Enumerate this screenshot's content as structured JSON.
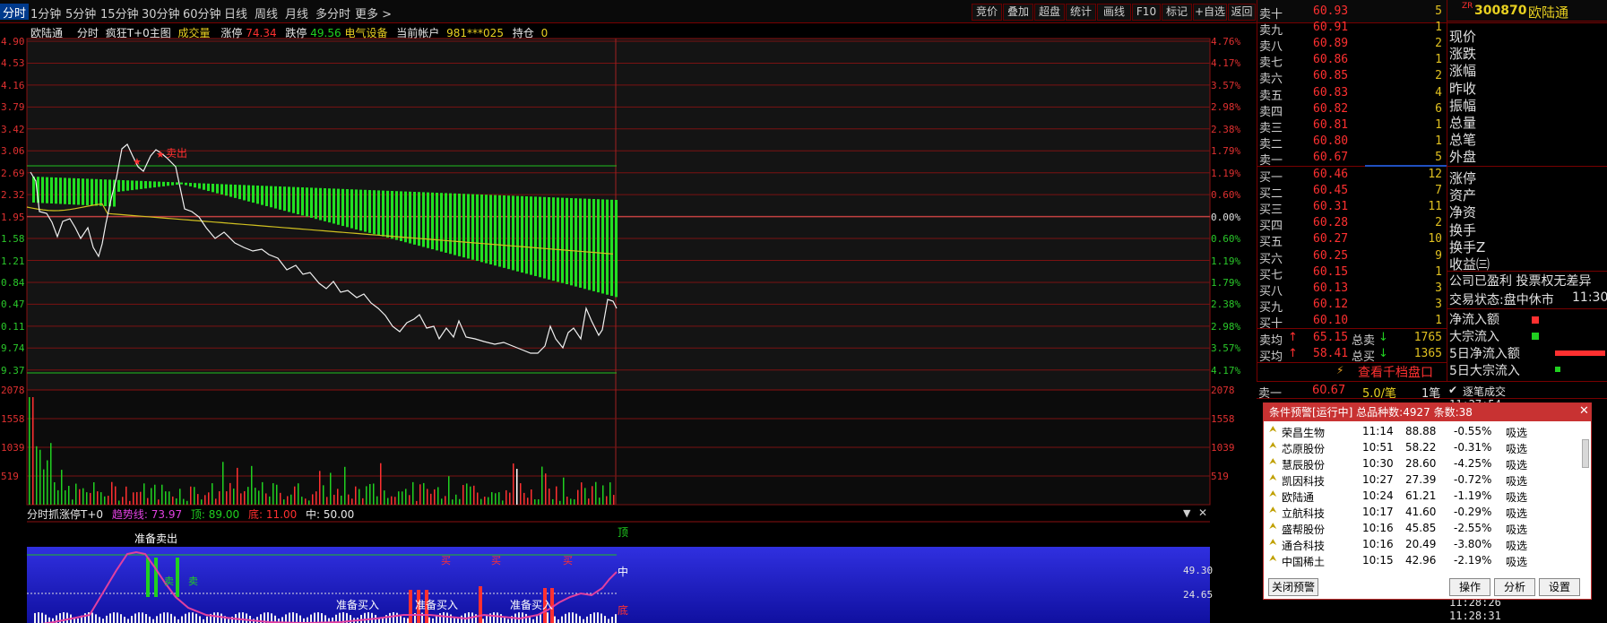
{
  "toolbar": {
    "periods": [
      "分时",
      "1分钟",
      "5分钟",
      "15分钟",
      "30分钟",
      "60分钟",
      "日线",
      "周线",
      "月线",
      "多分时",
      "更多 >"
    ],
    "right_buttons": [
      "竞价",
      "叠加",
      "超盘",
      "统计",
      "画线",
      "F10",
      "标记",
      "+自选",
      "返回"
    ]
  },
  "info_line": {
    "name": "欧陆通",
    "mode": "分时",
    "indicator": "疯狂T+0主图",
    "volume_label": "成交量",
    "limit_up_label": "涨停",
    "limit_up_value": "74.34",
    "limit_down_label": "跌停",
    "limit_down_value": "49.56",
    "sector": "电气设备",
    "account_label": "当前帐户",
    "account_value": "981***025",
    "position_label": "持仓",
    "position_value": "0"
  },
  "price_axis": {
    "left": [
      "4.90",
      "4.53",
      "4.16",
      "3.79",
      "3.42",
      "3.06",
      "2.69",
      "2.32",
      "1.95",
      "1.58",
      "1.21",
      "0.84",
      "0.47",
      "0.11",
      "9.74",
      "9.37"
    ],
    "right": [
      "4.76%",
      "4.17%",
      "3.57%",
      "2.98%",
      "2.38%",
      "1.79%",
      "1.19%",
      "0.60%",
      "0.00%",
      "0.60%",
      "1.19%",
      "1.79%",
      "2.38%",
      "2.98%",
      "3.57%",
      "4.17%"
    ]
  },
  "volume_axis": {
    "left": [
      "2078",
      "1558",
      "1039",
      "519"
    ],
    "right": [
      "2078",
      "1558",
      "1039",
      "519"
    ]
  },
  "chart_annotations": {
    "sell_out": "卖出"
  },
  "indicator2": {
    "title": "分时抓涨停T+0",
    "trend_label": "趋势线:",
    "trend_value": "73.97",
    "top_label": "顶:",
    "top_value": "89.00",
    "bottom_label": "底:",
    "bottom_value": "11.00",
    "mid_label": "中:",
    "mid_value": "50.00",
    "right_axis": [
      "49.30",
      "24.65"
    ],
    "tag_top": "顶",
    "tag_mid": "中",
    "tag_bottom": "底",
    "ready_sell": "准备卖出",
    "ready_buy": "准备买入",
    "buy": "买",
    "sell": "卖"
  },
  "order_book": {
    "asks": [
      {
        "label": "卖十",
        "price": "60.93",
        "vol": "5"
      },
      {
        "label": "卖九",
        "price": "60.91",
        "vol": "1"
      },
      {
        "label": "卖八",
        "price": "60.89",
        "vol": "2"
      },
      {
        "label": "卖七",
        "price": "60.86",
        "vol": "1"
      },
      {
        "label": "卖六",
        "price": "60.85",
        "vol": "2"
      },
      {
        "label": "卖五",
        "price": "60.83",
        "vol": "4"
      },
      {
        "label": "卖四",
        "price": "60.82",
        "vol": "6"
      },
      {
        "label": "卖三",
        "price": "60.81",
        "vol": "1"
      },
      {
        "label": "卖二",
        "price": "60.80",
        "vol": "1"
      },
      {
        "label": "卖一",
        "price": "60.67",
        "vol": "5"
      }
    ],
    "bids": [
      {
        "label": "买一",
        "price": "60.46",
        "vol": "12"
      },
      {
        "label": "买二",
        "price": "60.45",
        "vol": "7"
      },
      {
        "label": "买三",
        "price": "60.31",
        "vol": "11"
      },
      {
        "label": "买四",
        "price": "60.28",
        "vol": "2"
      },
      {
        "label": "买五",
        "price": "60.27",
        "vol": "10"
      },
      {
        "label": "买六",
        "price": "60.25",
        "vol": "9"
      },
      {
        "label": "买七",
        "price": "60.15",
        "vol": "1"
      },
      {
        "label": "买八",
        "price": "60.13",
        "vol": "3"
      },
      {
        "label": "买九",
        "price": "60.12",
        "vol": "3"
      },
      {
        "label": "买十",
        "price": "60.10",
        "vol": "1"
      }
    ],
    "avg_sell_label": "卖均",
    "avg_sell_price": "65.15",
    "total_sell_label": "总卖",
    "total_sell_vol": "1765",
    "avg_buy_label": "买均",
    "avg_buy_price": "58.41",
    "total_buy_label": "总买",
    "total_buy_vol": "1365",
    "thousand_link": "查看千档盘口",
    "last_label": "卖一",
    "last_price": "60.67",
    "last_per": "5.0/笔",
    "last_count": "1笔",
    "tick_label": "逐笔成交"
  },
  "quote": {
    "badge": "ZR",
    "code": "300870",
    "name": "欧陆通",
    "fields": [
      "现价",
      "涨跌",
      "涨幅",
      "昨收",
      "振幅",
      "总量",
      "总笔",
      "外盘",
      "涨停",
      "资产",
      "净资",
      "换手",
      "换手Z",
      "收益㈢"
    ],
    "company_line": "公司已盈利 投票权无差异",
    "status_label": "交易状态:盘中休市",
    "status_time": "11:30",
    "flows": [
      "净流入额",
      "大宗流入",
      "5日净流入额",
      "5日大宗流入"
    ]
  },
  "alert": {
    "title": "条件预警[运行中] 总品种数:4927 条数:38",
    "rows": [
      {
        "name": "荣昌生物",
        "time": "11:14",
        "price": "88.88",
        "pct": "-0.55%",
        "action": "吸选"
      },
      {
        "name": "芯原股份",
        "time": "10:51",
        "price": "58.22",
        "pct": "-0.31%",
        "action": "吸选"
      },
      {
        "name": "慧辰股份",
        "time": "10:30",
        "price": "28.60",
        "pct": "-4.25%",
        "action": "吸选"
      },
      {
        "name": "凯因科技",
        "time": "10:27",
        "price": "27.39",
        "pct": "-0.72%",
        "action": "吸选"
      },
      {
        "name": "欧陆通",
        "time": "10:24",
        "price": "61.21",
        "pct": "-1.19%",
        "action": "吸选"
      },
      {
        "name": "立航科技",
        "time": "10:17",
        "price": "41.60",
        "pct": "-0.29%",
        "action": "吸选"
      },
      {
        "name": "盛帮股份",
        "time": "10:16",
        "price": "45.85",
        "pct": "-2.55%",
        "action": "吸选"
      },
      {
        "name": "通合科技",
        "time": "10:16",
        "price": "20.49",
        "pct": "-3.80%",
        "action": "吸选"
      },
      {
        "name": "中国稀土",
        "time": "10:15",
        "price": "42.96",
        "pct": "-2.19%",
        "action": "吸选"
      }
    ],
    "close_btn": "关闭预警",
    "op_btn": "操作",
    "analyze_btn": "分析",
    "settings_btn": "设置"
  },
  "tick_times": [
    "11:27:54",
    "11:28:26",
    "11:28:31"
  ],
  "colors": {
    "up": "#ff3030",
    "down": "#20d020",
    "accent": "#003a8c",
    "panel": "#2020c8"
  }
}
